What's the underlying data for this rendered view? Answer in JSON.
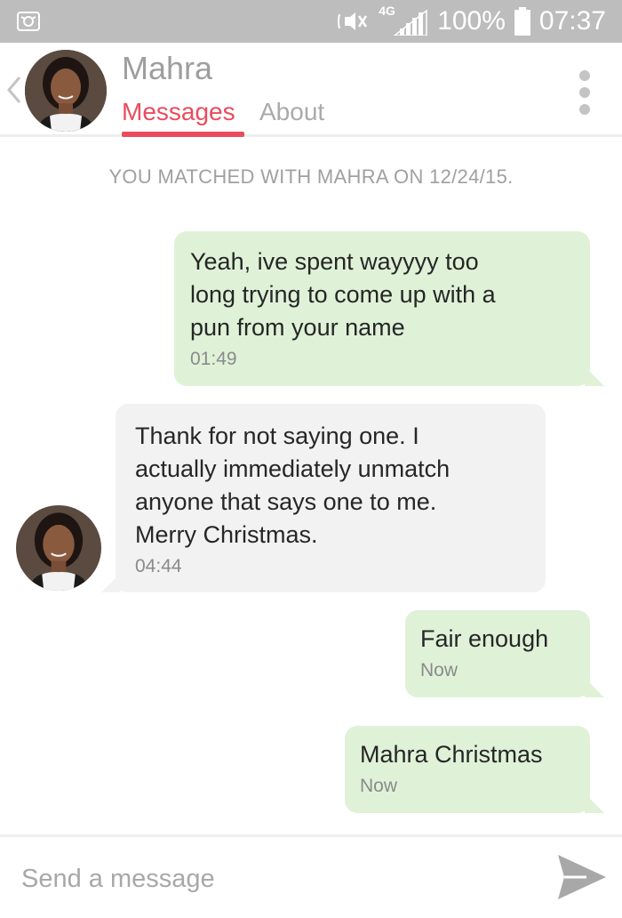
{
  "status_bar": {
    "network": "4G",
    "battery": "100%",
    "time": "07:37",
    "icons": [
      "app-notification-icon",
      "mute-icon",
      "signal-icon",
      "battery-icon"
    ]
  },
  "header": {
    "contact_name": "Mahra",
    "tabs": [
      {
        "label": "Messages",
        "active": true
      },
      {
        "label": "About",
        "active": false
      }
    ],
    "icons": [
      "back-icon",
      "more-options-icon"
    ]
  },
  "chat": {
    "match_banner": "YOU MATCHED WITH MAHRA ON 12/24/15.",
    "messages": [
      {
        "direction": "outgoing",
        "text": "Yeah, ive spent wayyyy too\nlong trying to come up with a\npun from your name",
        "time": "01:49"
      },
      {
        "direction": "incoming",
        "text": "Thank for not saying one. I\nactually immediately unmatch\nanyone that says one to me.\nMerry Christmas.",
        "time": "04:44"
      },
      {
        "direction": "outgoing",
        "text": "Fair enough",
        "time": "Now"
      },
      {
        "direction": "outgoing",
        "text": "Mahra Christmas",
        "time": "Now"
      }
    ]
  },
  "composer": {
    "placeholder": "Send a message",
    "value": ""
  },
  "colors": {
    "accent": "#ea4c5e",
    "status_bar": "#bdbdbd",
    "outgoing_bubble": "#dff2d8",
    "incoming_bubble": "#f2f2f2",
    "send_icon": "#a8a8a8"
  }
}
